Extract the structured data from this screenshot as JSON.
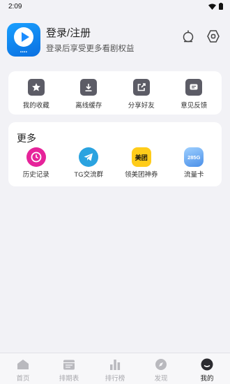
{
  "status_bar": {
    "time": "2:09"
  },
  "profile": {
    "title": "登录/注册",
    "subtitle": "登录后享受更多看剧权益"
  },
  "actions": [
    {
      "label": "我的收藏",
      "icon": "star-icon"
    },
    {
      "label": "离线缓存",
      "icon": "download-icon"
    },
    {
      "label": "分享好友",
      "icon": "share-icon"
    },
    {
      "label": "意见反馈",
      "icon": "feedback-icon"
    }
  ],
  "more": {
    "title": "更多",
    "items": [
      {
        "label": "历史记录",
        "icon": "history-icon",
        "color": "#e6239a"
      },
      {
        "label": "TG交流群",
        "icon": "telegram-icon",
        "color": "#2aa3e0"
      },
      {
        "label": "领美团神券",
        "icon": "meituan-icon",
        "color": "#ffcc1a",
        "badge": "美团"
      },
      {
        "label": "流量卡",
        "icon": "data-card-icon",
        "color": "#5aa8f0",
        "badge": "285G"
      }
    ]
  },
  "tabbar": {
    "tabs": [
      {
        "label": "首页",
        "icon": "home-icon",
        "active": false
      },
      {
        "label": "排期表",
        "icon": "calendar-icon",
        "active": false
      },
      {
        "label": "排行榜",
        "icon": "ranking-icon",
        "active": false
      },
      {
        "label": "发现",
        "icon": "compass-icon",
        "active": false
      },
      {
        "label": "我的",
        "icon": "profile-icon",
        "active": true
      }
    ]
  },
  "colors": {
    "background": "#f2f2f6",
    "icon_dark": "#5c5c66",
    "tab_inactive": "#a9a9ae",
    "tab_active": "#222222"
  }
}
